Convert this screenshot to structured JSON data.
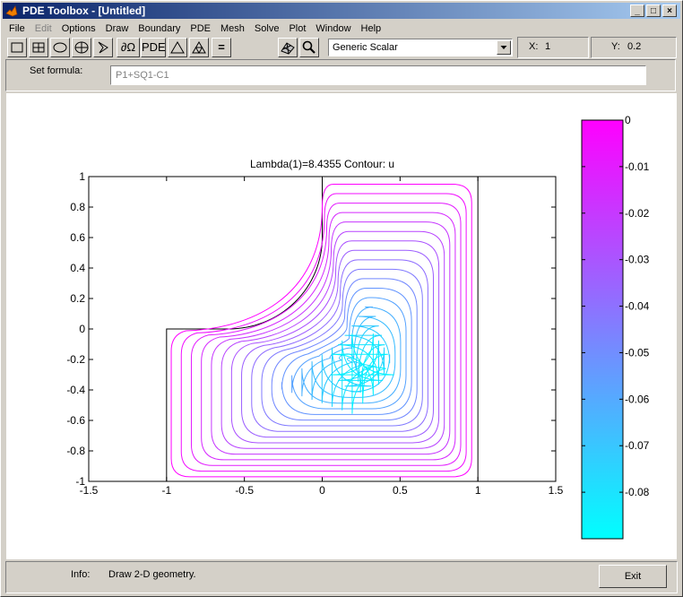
{
  "window": {
    "title": "PDE Toolbox - [Untitled]",
    "minimize": "_",
    "maximize": "□",
    "close": "×"
  },
  "menu": [
    {
      "label": "File",
      "enabled": true
    },
    {
      "label": "Edit",
      "enabled": false
    },
    {
      "label": "Options",
      "enabled": true
    },
    {
      "label": "Draw",
      "enabled": true
    },
    {
      "label": "Boundary",
      "enabled": true
    },
    {
      "label": "PDE",
      "enabled": true
    },
    {
      "label": "Mesh",
      "enabled": true
    },
    {
      "label": "Solve",
      "enabled": true
    },
    {
      "label": "Plot",
      "enabled": true
    },
    {
      "label": "Window",
      "enabled": true
    },
    {
      "label": "Help",
      "enabled": true
    }
  ],
  "toolbar": {
    "boundary_label": "∂Ω",
    "pde_label": "PDE",
    "solve_label": "=",
    "application_select": "Generic Scalar",
    "x_label": "X:",
    "x_value": "1",
    "y_label": "Y:",
    "y_value": "0.2"
  },
  "formula": {
    "label": "Set formula:",
    "value": "P1+SQ1-C1"
  },
  "chart_data": {
    "type": "contour",
    "title": "Lambda(1)=8.4355    Contour: u",
    "xlim": [
      -1.5,
      1.5
    ],
    "ylim": [
      -1,
      1
    ],
    "xticks": [
      "-1.5",
      "-1",
      "-0.5",
      "0",
      "0.5",
      "1",
      "1.5"
    ],
    "yticks": [
      "1",
      "0.8",
      "0.6",
      "0.4",
      "0.2",
      "0",
      "-0.2",
      "-0.4",
      "-0.6",
      "-0.8",
      "-1"
    ],
    "contour_levels": 19,
    "contour_center": [
      0.28,
      -0.25
    ],
    "geometry_boundary": [
      [
        -1,
        -1
      ],
      [
        1,
        -1
      ],
      [
        1,
        1
      ],
      [
        0,
        1
      ],
      [
        0,
        0.6
      ],
      [
        -0.6,
        0
      ],
      [
        -1,
        0
      ]
    ],
    "colorbar": {
      "min": -0.09,
      "max": 0,
      "ticks": [
        "0",
        "-0.01",
        "-0.02",
        "-0.03",
        "-0.04",
        "-0.05",
        "-0.06",
        "-0.07",
        "-0.08"
      ],
      "color_top": "#ff00ff",
      "color_bottom": "#00ffff"
    }
  },
  "status": {
    "info_label": "Info:",
    "info_text": "Draw 2-D geometry.",
    "exit_label": "Exit"
  }
}
